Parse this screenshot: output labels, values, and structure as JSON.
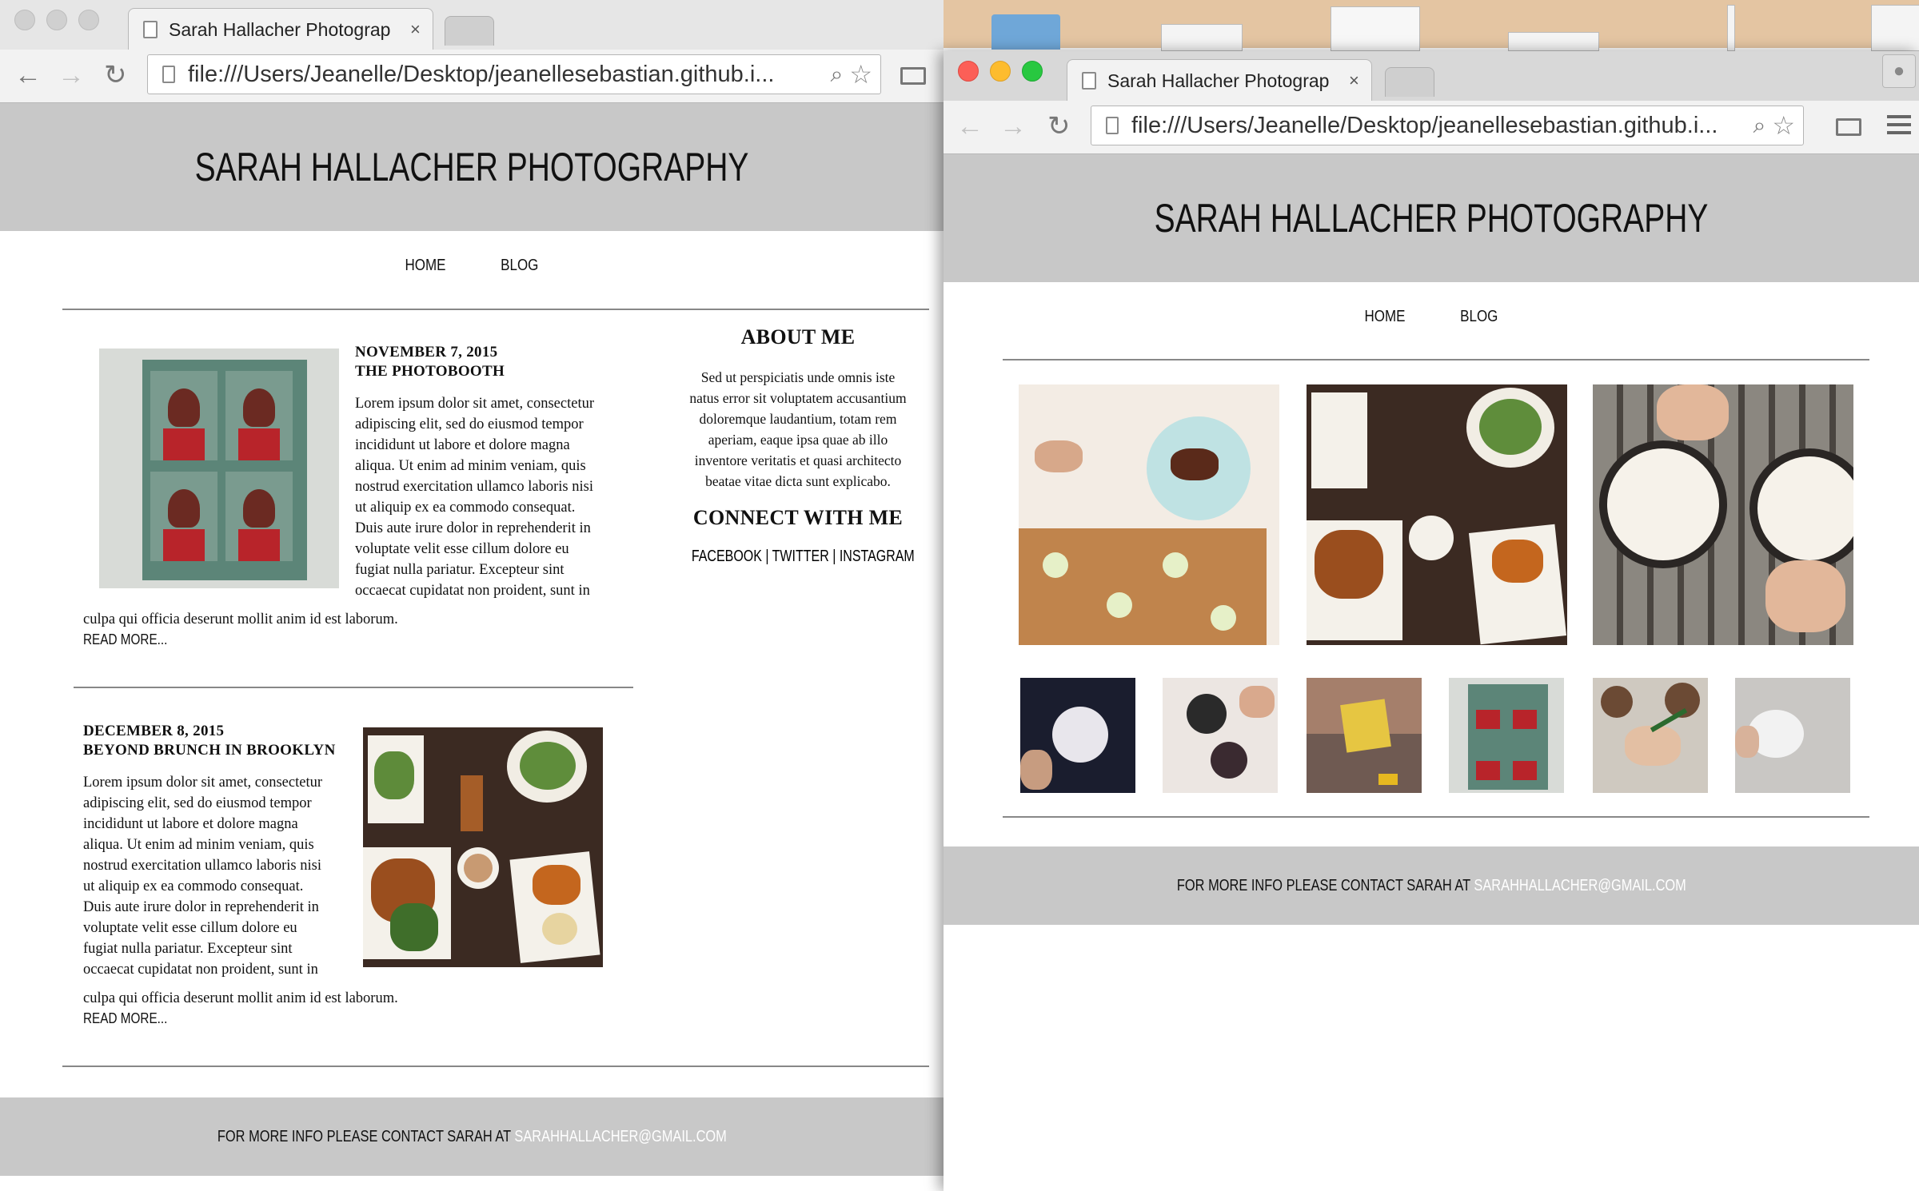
{
  "desktop": {
    "bg_colors": [
      "#e7c9a8",
      "#d8b893"
    ]
  },
  "left_window": {
    "tab": {
      "title": "Sarah Hallacher Photograp",
      "close": "×"
    },
    "address": {
      "url": "file:///Users/Jeanelle/Desktop/jeanellesebastian.github.i..."
    },
    "site": {
      "title": "SARAH HALLACHER PHOTOGRAPHY",
      "nav": [
        "HOME",
        "BLOG"
      ],
      "posts": [
        {
          "date": "NOVEMBER 7, 2015",
          "title": "THE PHOTOBOOTH",
          "body_lines_side": [
            "Lorem ipsum dolor sit amet, consectetur",
            "adipiscing elit, sed do eiusmod tempor",
            "incididunt ut labore et dolore magna",
            "aliqua. Ut enim ad minim veniam, quis",
            "nostrud exercitation ullamco laboris nisi",
            "ut aliquip ex ea commodo consequat.",
            "Duis aute irure dolor in reprehenderit in",
            "voluptate velit esse cillum dolore eu",
            "fugiat nulla pariatur. Excepteur sint",
            "occaecat cupidatat non proident, sunt in"
          ],
          "body_last": "culpa qui officia deserunt mollit anim id est laborum.",
          "read_more": "READ MORE..."
        },
        {
          "date": "DECEMBER 8, 2015",
          "title": "BEYOND BRUNCH IN BROOKLYN",
          "body_lines_side": [
            "Lorem ipsum dolor sit amet, consectetur",
            "adipiscing elit, sed do eiusmod tempor",
            "incididunt ut labore et dolore magna",
            "aliqua. Ut enim ad minim veniam, quis",
            "nostrud exercitation ullamco laboris nisi",
            "ut aliquip ex ea commodo consequat.",
            "Duis aute irure dolor in reprehenderit in",
            "voluptate velit esse cillum dolore eu",
            "fugiat nulla pariatur. Excepteur sint",
            "occaecat cupidatat non proident, sunt in"
          ],
          "body_last": "culpa qui officia deserunt mollit anim id est laborum.",
          "read_more": "READ MORE..."
        }
      ],
      "sidebar": {
        "about_heading": "ABOUT ME",
        "about_lines": [
          "Sed ut perspiciatis unde omnis iste",
          "natus error sit voluptatem accusantium",
          "doloremque laudantium, totam rem",
          "aperiam, eaque ipsa quae ab illo",
          "inventore veritatis et quasi architecto",
          "beatae vitae dicta sunt explicabo."
        ],
        "connect_heading": "CONNECT WITH ME",
        "links": [
          "FACEBOOK",
          "TWITTER",
          "INSTAGRAM"
        ],
        "separator": "|"
      },
      "footer": {
        "text": "FOR MORE INFO PLEASE CONTACT SARAH AT",
        "email": "SARAHHALLACHER@GMAIL.COM"
      }
    }
  },
  "right_window": {
    "tab": {
      "title": "Sarah Hallacher Photograp",
      "close": "×"
    },
    "address": {
      "url": "file:///Users/Jeanelle/Desktop/jeanellesebastian.github.i..."
    },
    "site": {
      "title": "SARAH HALLACHER PHOTOGRAPHY",
      "nav": [
        "HOME",
        "BLOG"
      ],
      "footer": {
        "text": "FOR MORE INFO PLEASE CONTACT SARAH AT",
        "email": "SARAHHALLACHER@GMAIL.COM"
      }
    }
  },
  "icons": {
    "back": "back-arrow-icon",
    "forward": "forward-arrow-icon",
    "reload": "reload-icon",
    "zoom": "magnifier-icon",
    "star": "bookmark-star-icon",
    "cast": "cast-icon",
    "menu": "hamburger-menu-icon",
    "profile": "profile-icon"
  }
}
